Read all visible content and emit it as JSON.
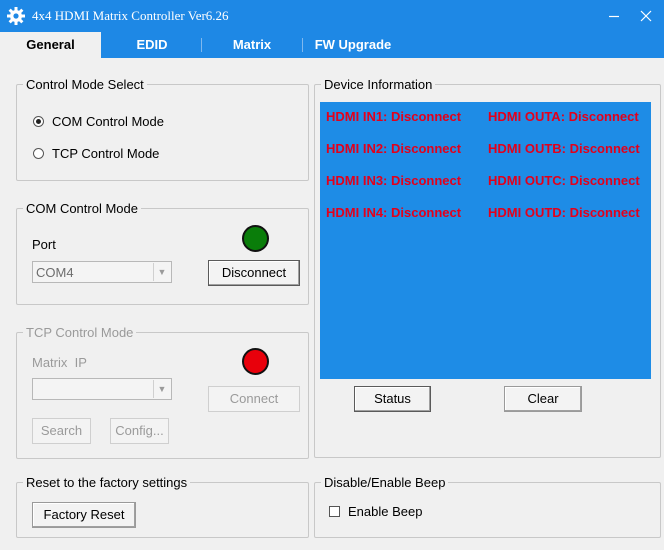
{
  "window": {
    "title": "4x4 HDMI Matrix Controller Ver6.26",
    "icon": "gear-icon"
  },
  "tabs": [
    {
      "label": "General",
      "active": true
    },
    {
      "label": "EDID",
      "active": false
    },
    {
      "label": "Matrix",
      "active": false
    },
    {
      "label": "FW Upgrade",
      "active": false
    }
  ],
  "control_mode": {
    "title": "Control Mode Select",
    "options": [
      {
        "label": "COM Control Mode",
        "checked": true
      },
      {
        "label": "TCP Control Mode",
        "checked": false
      }
    ]
  },
  "com_mode": {
    "title": "COM Control Mode",
    "port_label": "Port",
    "port_value": "COM4",
    "button_label": "Disconnect",
    "status_color": "#0a7d0a"
  },
  "tcp_mode": {
    "title": "TCP Control Mode",
    "ip_label": "Matrix  IP",
    "ip_value": "",
    "connect_label": "Connect",
    "search_label": "Search",
    "config_label": "Config...",
    "status_color": "#e8000b"
  },
  "device_info": {
    "title": "Device Information",
    "panel_color": "#1e8ce6",
    "text_color": "#e3001b",
    "inputs": [
      "HDMI IN1: Disconnect",
      "HDMI IN2: Disconnect",
      "HDMI IN3: Disconnect",
      "HDMI IN4: Disconnect"
    ],
    "outputs": [
      "HDMI OUTA: Disconnect",
      "HDMI OUTB: Disconnect",
      "HDMI OUTC: Disconnect",
      "HDMI OUTD: Disconnect"
    ],
    "status_label": "Status",
    "clear_label": "Clear"
  },
  "factory": {
    "title": "Reset to the factory settings",
    "button_label": "Factory Reset"
  },
  "beep": {
    "title": "Disable/Enable Beep",
    "checkbox_label": "Enable Beep",
    "checked": false
  },
  "theme": {
    "accent": "#1e88e5"
  }
}
